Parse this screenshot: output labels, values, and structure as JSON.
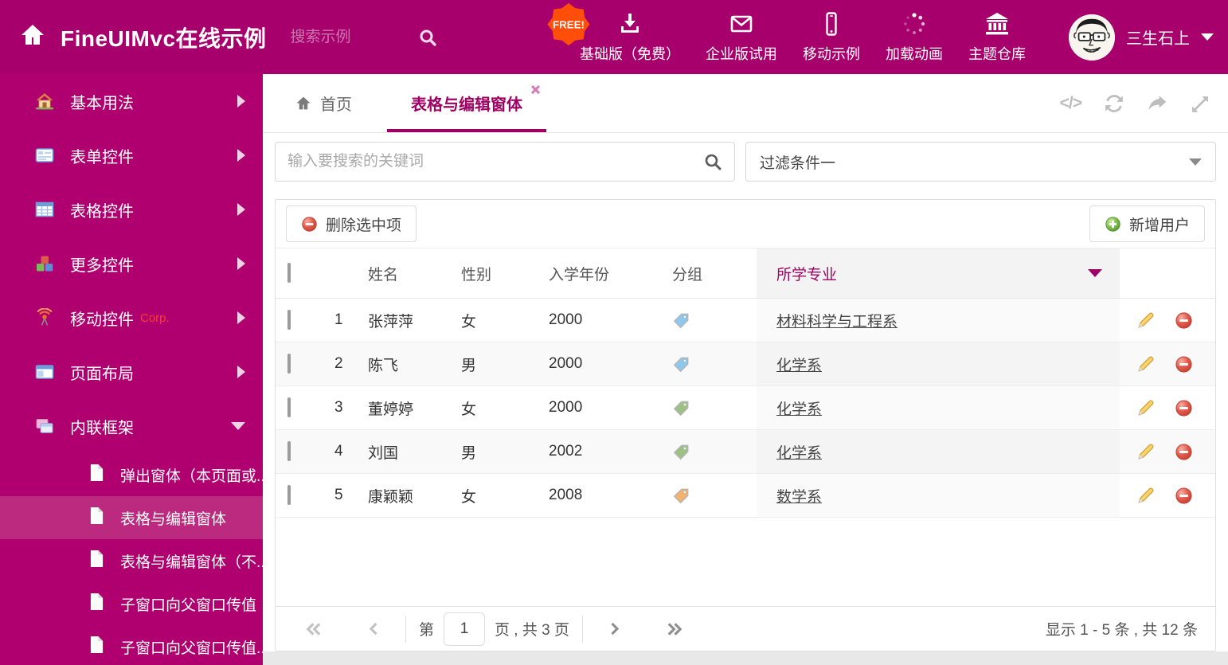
{
  "colors": {
    "header_bg": "#A7006C",
    "sidebar_bg": "#B00070",
    "sidebar_active_bg": "#BC2A80",
    "accent": "#9E0063",
    "free_badge": "#FF4E0A",
    "tag_blue": "#8CC8F0",
    "tag_green": "#9DC183",
    "tag_orange": "#F6B26B"
  },
  "icons": {
    "code": "</>"
  },
  "header": {
    "title": "FineUIMvc在线示例",
    "search_placeholder": "搜索示例",
    "free_badge": "FREE!",
    "nav": [
      {
        "label": "基础版（免费）",
        "icon": "download-icon"
      },
      {
        "label": "企业版试用",
        "icon": "envelope-icon"
      },
      {
        "label": "移动示例",
        "icon": "mobile-icon"
      },
      {
        "label": "加载动画",
        "icon": "spinner-icon"
      },
      {
        "label": "主题仓库",
        "icon": "bank-icon"
      }
    ],
    "user_name": "三生石上"
  },
  "sidebar": {
    "items": [
      {
        "label": "基本用法"
      },
      {
        "label": "表单控件"
      },
      {
        "label": "表格控件"
      },
      {
        "label": "更多控件"
      },
      {
        "label": "移动控件",
        "badge": "Corp."
      },
      {
        "label": "页面布局"
      },
      {
        "label": "内联框架"
      }
    ],
    "subitems": [
      {
        "label": "弹出窗体（本页面或..."
      },
      {
        "label": "表格与编辑窗体"
      },
      {
        "label": "表格与编辑窗体（不..."
      },
      {
        "label": "子窗口向父窗口传值"
      },
      {
        "label": "子窗口向父窗口传值..."
      }
    ]
  },
  "tabs": {
    "home_label": "首页",
    "active_label": "表格与编辑窗体"
  },
  "filter": {
    "search_placeholder": "输入要搜索的关键词",
    "dropdown_value": "过滤条件一"
  },
  "toolbar": {
    "delete_label": "删除选中项",
    "add_label": "新增用户"
  },
  "table": {
    "headers": {
      "name": "姓名",
      "gender": "性别",
      "year": "入学年份",
      "group": "分组",
      "major": "所学专业"
    },
    "rows": [
      {
        "num": "1",
        "name": "张萍萍",
        "gender": "女",
        "year": "2000",
        "tag": "blue",
        "major": "材料科学与工程系"
      },
      {
        "num": "2",
        "name": "陈飞",
        "gender": "男",
        "year": "2000",
        "tag": "blue",
        "major": "化学系"
      },
      {
        "num": "3",
        "name": "董婷婷",
        "gender": "女",
        "year": "2000",
        "tag": "green",
        "major": "化学系"
      },
      {
        "num": "4",
        "name": "刘国",
        "gender": "男",
        "year": "2002",
        "tag": "green",
        "major": "化学系"
      },
      {
        "num": "5",
        "name": "康颖颖",
        "gender": "女",
        "year": "2008",
        "tag": "orange",
        "major": "数学系"
      }
    ]
  },
  "pagination": {
    "page_prefix": "第",
    "page_value": "1",
    "page_suffix": "页 , 共 3 页",
    "summary": "显示 1 - 5 条 , 共 12 条"
  }
}
